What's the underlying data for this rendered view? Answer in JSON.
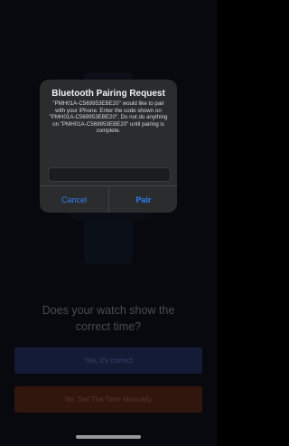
{
  "screen": {
    "question": "Does your watch show the correct time?",
    "yes_button": "Yes, it's correct",
    "no_button": "No, Set The Time Manually"
  },
  "alert": {
    "title": "Bluetooth Pairing Request",
    "message": "\"PMH01A-C569953EBE20\" would like to pair with your iPhone. Enter the code shown on \"PMH01A-C569953EBE20\". Do not do anything on \"PMH01A-C569953EBE20\" until pairing is complete.",
    "input_value": "",
    "cancel_label": "Cancel",
    "pair_label": "Pair"
  },
  "colors": {
    "accent": "#2f7ff0",
    "yes_button": "#1f2a55",
    "no_button": "#4a2213"
  }
}
